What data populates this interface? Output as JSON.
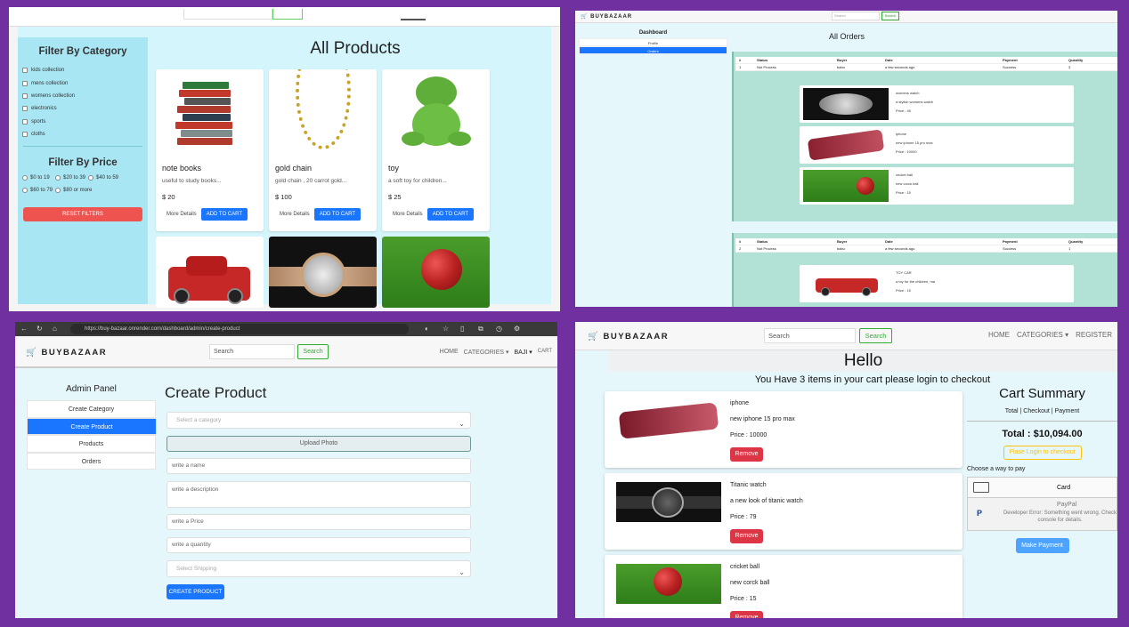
{
  "products_page": {
    "title": "All Products",
    "filter_category_title": "Filter By Category",
    "categories": [
      "kids collection",
      "mens collection",
      "womens collection",
      "electronics",
      "sports",
      "cloths"
    ],
    "filter_price_title": "Filter By Price",
    "prices": [
      "$0 to 19",
      "$20 to 39",
      "$40 to 59",
      "$60 to 79",
      "$80 or more"
    ],
    "reset_label": "RESET FILTERS",
    "more_label": "More Details",
    "add_label": "ADD TO CART",
    "products": [
      {
        "name": "note books",
        "desc": "useful to study books...",
        "price": "$ 20"
      },
      {
        "name": "gold chain",
        "desc": "gold chain , 20 carrot gold...",
        "price": "$ 100"
      },
      {
        "name": "toy",
        "desc": "a soft toy for children...",
        "price": "$ 25"
      }
    ]
  },
  "orders_page": {
    "brand": "BUYBAZAAR",
    "search_placeholder": "Search",
    "search_button": "Search",
    "sidebar_title": "Dashboard",
    "sidebar_items": [
      "Profile",
      "Orders"
    ],
    "title": "All Orders",
    "headers": [
      "#",
      "Status",
      "Buyer",
      "Date",
      "Payment",
      "Quantity"
    ],
    "orders": [
      {
        "row": [
          "1",
          "Not Process",
          "babu",
          "a few seconds ago",
          "Success",
          "3"
        ],
        "items": [
          {
            "name": "womens watch",
            "desc": "a stylish womens watch",
            "price": "Price : 45"
          },
          {
            "name": "iphone",
            "desc": "new iphone 15 pro max",
            "price": "Price : 10000"
          },
          {
            "name": "cricket ball",
            "desc": "new corck ball",
            "price": "Price : 15"
          }
        ]
      },
      {
        "row": [
          "2",
          "Not Process",
          "babu",
          "a few seconds ago",
          "Success",
          "1"
        ],
        "items": [
          {
            "name": "TOY CAR",
            "desc": "a toy for the children, ma",
            "price": "Price : 15"
          }
        ]
      }
    ]
  },
  "create_page": {
    "url": "https://buy-bazaar.onrender.com/dashboard/admin/create-product",
    "brand": "BUYBAZAAR",
    "search_placeholder": "Search",
    "search_button": "Search",
    "nav_links": [
      "HOME",
      "CATEGORIES ▾",
      "BAJI ▾",
      "CART"
    ],
    "sidebar_title": "Admin Panel",
    "sidebar_items": [
      "Create Category",
      "Create Product",
      "Products",
      "Orders"
    ],
    "title": "Create Product",
    "select_category": "Select a category",
    "upload_label": "Upload Photo",
    "name_placeholder": "write a name",
    "desc_placeholder": "write a description",
    "price_placeholder": "write a Price",
    "quantity_placeholder": "write a quantity",
    "shipping_placeholder": "Select Shipping",
    "create_button": "CREATE PRODUCT"
  },
  "cart_page": {
    "brand": "BUYBAZAAR",
    "search_placeholder": "Search",
    "search_button": "Search",
    "nav_links": [
      "HOME",
      "CATEGORIES ▾",
      "REGISTER"
    ],
    "hello": "Hello",
    "message": "You Have 3 items in your cart please login to checkout",
    "remove_label": "Remove",
    "items": [
      {
        "name": "iphone",
        "desc": "new iphone 15 pro max",
        "price": "Price : 10000"
      },
      {
        "name": "Titanic watch",
        "desc": "a new look of titanic watch",
        "price": "Price : 79"
      },
      {
        "name": "cricket ball",
        "desc": "new corck ball",
        "price": "Price : 15"
      }
    ],
    "summary_title": "Cart Summary",
    "summary_sub": "Total | Checkout | Payment",
    "total": "Total : $10,094.00",
    "login_button": "Plase Login to checkout",
    "pay_way": "Choose a way to pay",
    "card_label": "Card",
    "paypal_label": "PayPal",
    "paypal_error": "Developer Error: Something went wrong. Check console for details.",
    "make_payment": "Make Payment"
  }
}
